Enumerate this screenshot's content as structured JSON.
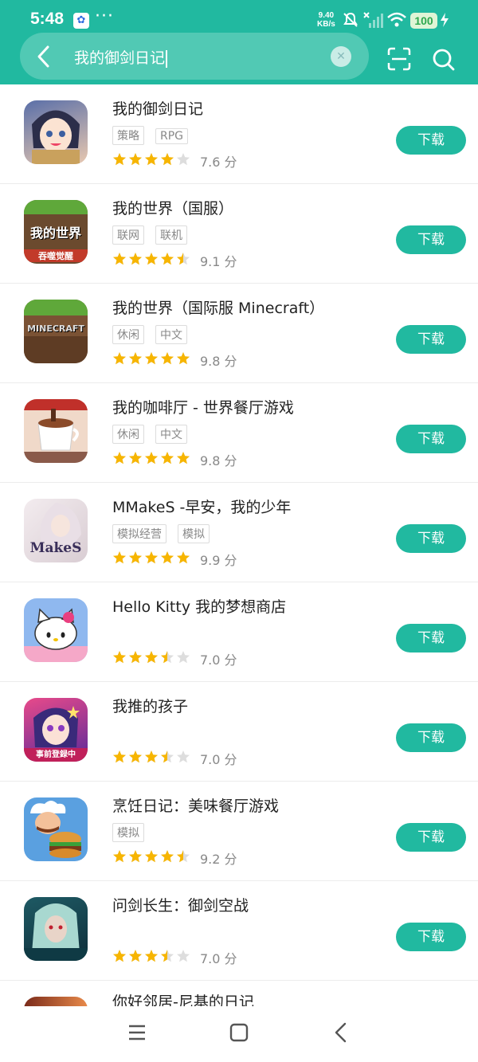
{
  "status_bar": {
    "time": "5:48",
    "dots": "···",
    "net_speed_value": "9.40",
    "net_speed_unit": "KB/s",
    "battery": "100"
  },
  "search": {
    "query": "我的御剑日记"
  },
  "colors": {
    "accent": "#21b9a0",
    "star": "#f7b500",
    "star_empty": "#dddddd"
  },
  "download_label": "下载",
  "score_unit": "分",
  "apps": [
    {
      "name": "我的御剑日记",
      "tags": [
        "策略",
        "RPG"
      ],
      "rating": 4.0,
      "score": "7.6",
      "icon": "anime-girl-icon"
    },
    {
      "name": "我的世界（国服）",
      "tags": [
        "联网",
        "联机"
      ],
      "rating": 4.5,
      "score": "9.1",
      "icon": "minecraft-cn-icon",
      "icon_text": [
        "我的世界",
        "吞噬觉醒"
      ]
    },
    {
      "name": "我的世界（国际服 Minecraft）",
      "tags": [
        "休闲",
        "中文"
      ],
      "rating": 5.0,
      "score": "9.8",
      "icon": "minecraft-icon",
      "icon_text": [
        "MINECRAFT"
      ]
    },
    {
      "name": "我的咖啡厅 - 世界餐厅游戏",
      "tags": [
        "休闲",
        "中文"
      ],
      "rating": 5.0,
      "score": "9.8",
      "icon": "coffee-cup-icon"
    },
    {
      "name": "MMakeS -早安，我的少年",
      "tags": [
        "模拟经营",
        "模拟"
      ],
      "rating": 5.0,
      "score": "9.9",
      "icon": "mmakes-icon",
      "icon_text": [
        "MakeS"
      ]
    },
    {
      "name": "Hello Kitty 我的梦想商店",
      "tags": [],
      "rating": 3.5,
      "score": "7.0",
      "icon": "hello-kitty-icon"
    },
    {
      "name": "我推的孩子",
      "tags": [],
      "rating": 3.5,
      "score": "7.0",
      "icon": "oshi-no-ko-icon",
      "icon_text": [
        "事前登録中"
      ]
    },
    {
      "name": "烹饪日记：美味餐厅游戏",
      "tags": [
        "模拟"
      ],
      "rating": 4.5,
      "score": "9.2",
      "icon": "chef-burger-icon"
    },
    {
      "name": "问剑长生：御剑空战",
      "tags": [],
      "rating": 3.5,
      "score": "7.0",
      "icon": "swordsman-icon"
    }
  ],
  "partial_app": {
    "name": "你好邻居-尼基的日记"
  }
}
